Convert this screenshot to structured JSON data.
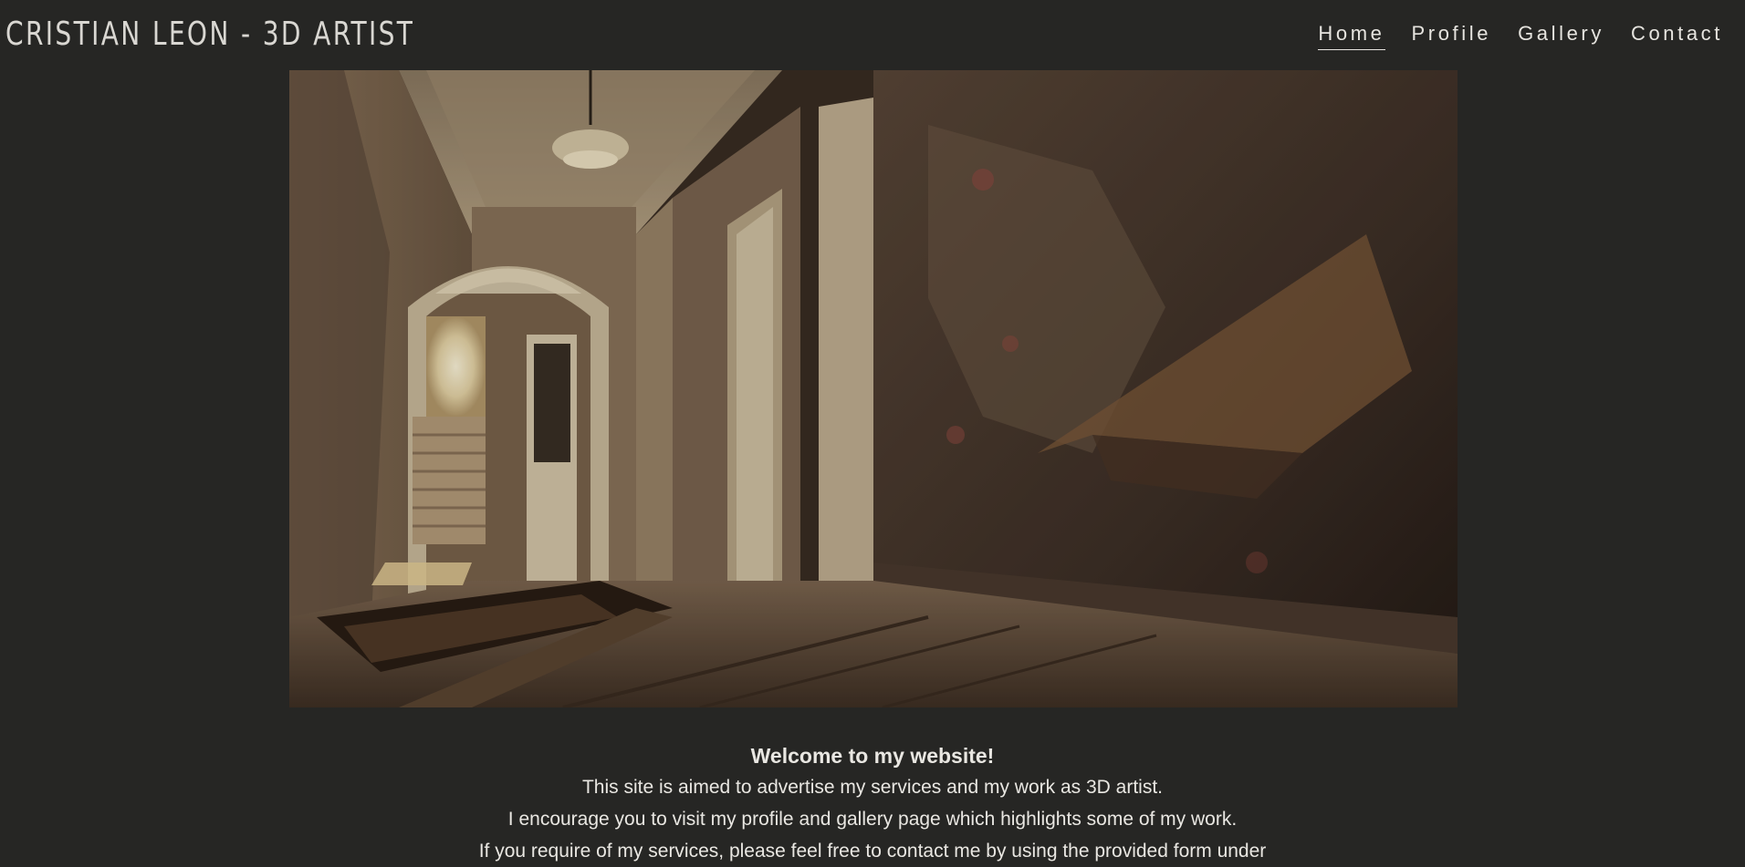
{
  "header": {
    "title": "CRISTIAN LEON - 3D ARTIST",
    "nav": [
      {
        "label": "Home",
        "active": true
      },
      {
        "label": "Profile",
        "active": false
      },
      {
        "label": "Gallery",
        "active": false
      },
      {
        "label": "Contact",
        "active": false
      }
    ]
  },
  "hero": {
    "image_icon": "abandoned-hallway-render"
  },
  "welcome": {
    "heading": "Welcome to my website!",
    "lines": [
      "This site is aimed to advertise my services and my work as 3D artist.",
      "I encourage you to visit my profile and gallery page which highlights some of my work.",
      "If you require of my services, please feel free to contact me by using the provided form under"
    ]
  },
  "colors": {
    "background": "#262624",
    "text": "#e6e4df"
  }
}
